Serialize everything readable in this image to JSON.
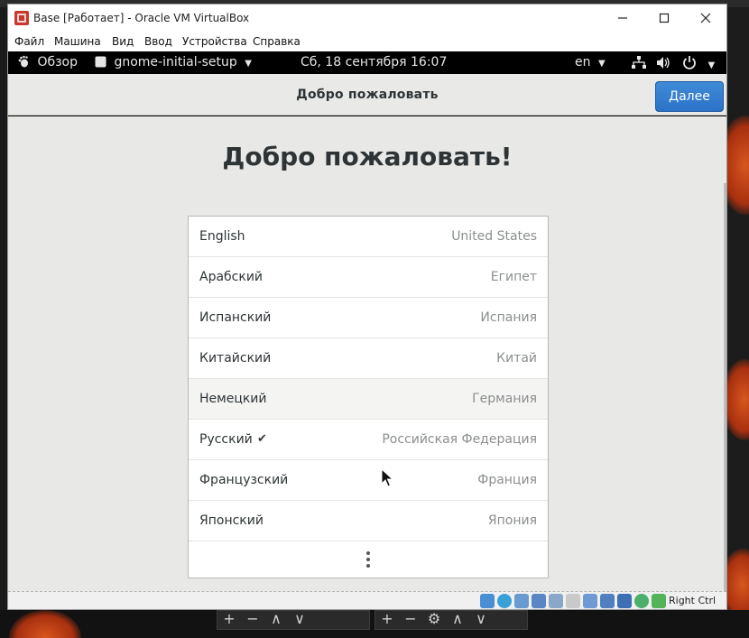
{
  "window": {
    "title": "Base [Работает] - Oracle VM VirtualBox",
    "menu": [
      "Файл",
      "Машина",
      "Вид",
      "Ввод",
      "Устройства",
      "Справка"
    ]
  },
  "gnome_topbar": {
    "activities": "Обзор",
    "app_name": "gnome-initial-setup",
    "clock": "Сб, 18 сентября  16:07",
    "input_source": "en"
  },
  "setup": {
    "header_title": "Добро пожаловать",
    "next_button": "Далее",
    "welcome_heading": "Добро пожаловать!",
    "languages": [
      {
        "name": "English",
        "region": "United States",
        "selected": false
      },
      {
        "name": "Арабский",
        "region": "Египет",
        "selected": false
      },
      {
        "name": "Испанский",
        "region": "Испания",
        "selected": false
      },
      {
        "name": "Китайский",
        "region": "Китай",
        "selected": false
      },
      {
        "name": "Немецкий",
        "region": "Германия",
        "selected": false
      },
      {
        "name": "Русский",
        "region": "Российская Федерация",
        "selected": true
      },
      {
        "name": "Французский",
        "region": "Франция",
        "selected": false
      },
      {
        "name": "Японский",
        "region": "Япония",
        "selected": false
      }
    ]
  },
  "statusbar": {
    "host_key": "Right Ctrl"
  },
  "icons": {
    "activities": "gnome-foot-icon",
    "app": "window-icon",
    "network": "network-icon",
    "volume": "volume-icon",
    "power": "power-icon",
    "more": "more-vertical-icon",
    "check": "checkmark-icon"
  },
  "colors": {
    "accent": "#3584e4",
    "header_bg": "#e9e9e7",
    "body_bg": "#e8e8e6"
  }
}
